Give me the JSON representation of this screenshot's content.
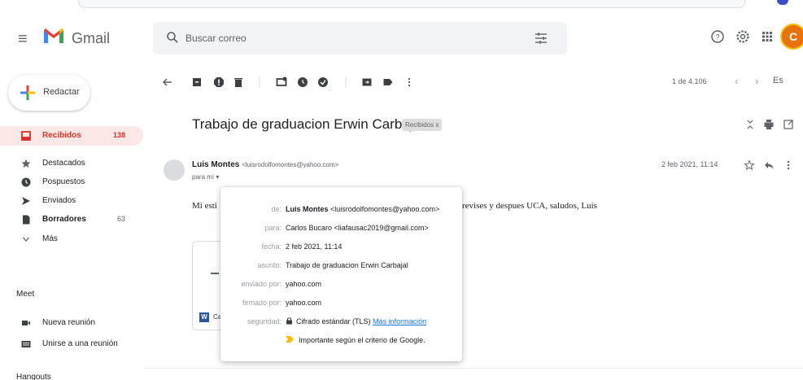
{
  "header": {
    "app_name": "Gmail",
    "search_placeholder": "Buscar correo",
    "avatar_letter": "C"
  },
  "sidebar": {
    "compose_label": "Redactar",
    "items": [
      {
        "label": "Recibidos",
        "count": "138",
        "icon": "inbox-icon"
      },
      {
        "label": "Destacados",
        "count": "",
        "icon": "star-icon"
      },
      {
        "label": "Pospuestos",
        "count": "",
        "icon": "clock-icon"
      },
      {
        "label": "Enviados",
        "count": "",
        "icon": "send-icon"
      },
      {
        "label": "Borradores",
        "count": "63",
        "icon": "draft-icon"
      },
      {
        "label": "Más",
        "count": "",
        "icon": "chevron-down-icon"
      }
    ],
    "meet_title": "Meet",
    "meet_items": [
      {
        "label": "Nueva reunión",
        "icon": "video-icon"
      },
      {
        "label": "Unirse a una reunión",
        "icon": "keyboard-icon"
      }
    ],
    "hangouts_title": "Hangouts"
  },
  "toolbar": {
    "pager": "1 de 4.106",
    "language": "Es"
  },
  "email": {
    "subject": "Trabajo de graduacion Erwin Carbajal",
    "label_chip": "Recibidos x",
    "sender_name": "Luis Montes",
    "sender_email": "<luisrodolfomontes@yahoo.com>",
    "to_me": "para mí ▾",
    "date": "2 feb 2021, 11:14",
    "body_start": "Mi esti",
    "body_end": "revises y despues UCA, saludos, Luis",
    "attachment_name": "Ca"
  },
  "details_popup": {
    "de_label": "de:",
    "de_name": "Luis Montes",
    "de_email": "<luisrodolfomontes@yahoo.com>",
    "para_label": "para:",
    "para_value": "Carlos Bucaro <liafausac2019@gmail.com>",
    "fecha_label": "fecha:",
    "fecha_value": "2 feb 2021, 11:14",
    "asunto_label": "asunto:",
    "asunto_value": "Trabajo de graduacion Erwin Carbajal",
    "enviado_label": "enviado por:",
    "enviado_value": "yahoo.com",
    "firmado_label": "firmado por:",
    "firmado_value": "yahoo.com",
    "seguridad_label": "seguridad:",
    "seguridad_value": "Cifrado estándar (TLS)",
    "seguridad_link": "Más información",
    "importance_text": "Importante según el criterio de Google."
  }
}
